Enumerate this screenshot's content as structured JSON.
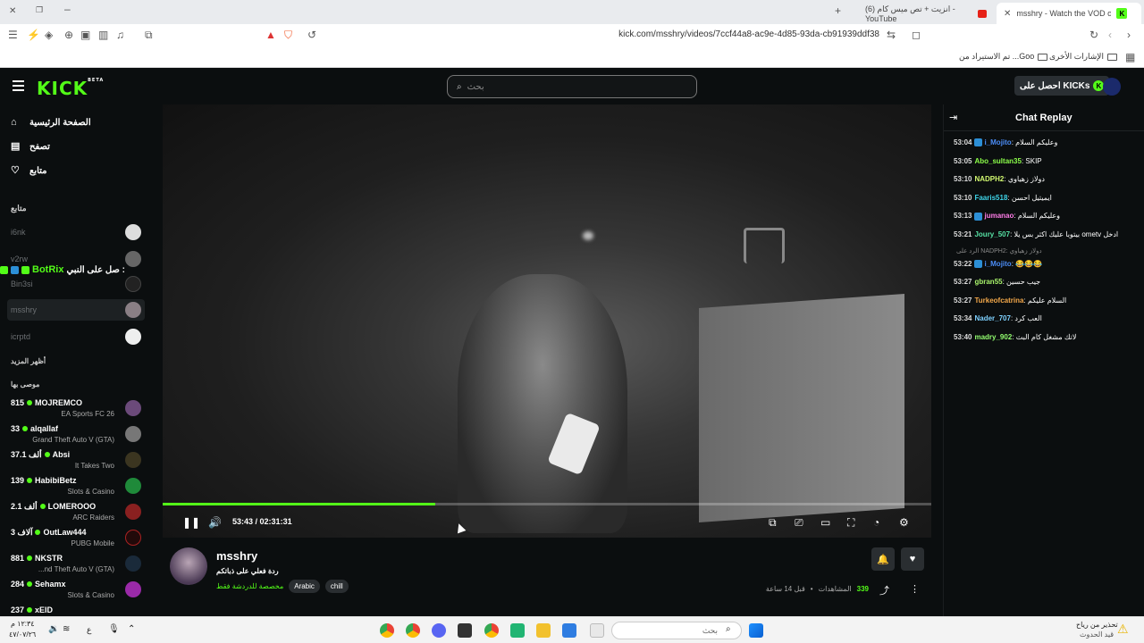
{
  "browser": {
    "tabs": [
      {
        "title": "(6) انزيت + تص ميس كام - YouTube"
      },
      {
        "title": "msshry - Watch the VOD on Kick",
        "active": true
      }
    ],
    "url": "kick.com/msshry/videos/7ccf44a8-ac9e-4d85-93da-cb91939ddf38",
    "bookmarks": [
      "الإشارات الأخرى",
      "تم الاستيراد من ...Goo"
    ]
  },
  "header": {
    "logo": "KICK",
    "logo_badge": "BETA",
    "search_placeholder": "بحث",
    "get_kicks": "احصل على KICKs"
  },
  "sidebar": {
    "nav": [
      {
        "label": "الصفحة الرئيسية",
        "icon": "home-icon"
      },
      {
        "label": "تصفح",
        "icon": "browse-icon"
      },
      {
        "label": "متابع",
        "icon": "heart-icon"
      }
    ],
    "following_title": "متابع",
    "following": [
      {
        "name": "i6nk"
      },
      {
        "name": "v2rw"
      },
      {
        "name": "Bin3si"
      },
      {
        "name": "msshry"
      },
      {
        "name": "icrptd"
      }
    ],
    "show_more": "أظهر المزيد",
    "recommended_title": "موصى بها",
    "recommended": [
      {
        "count": "815",
        "name": "MOJREMCO",
        "category": "EA Sports FC 26"
      },
      {
        "count": "33",
        "name": "alqallaf",
        "category": "Grand Theft Auto V (GTA)"
      },
      {
        "count": "37.1 ألف",
        "name": "Absi",
        "category": "It Takes Two"
      },
      {
        "count": "139",
        "name": "HabibiBetz",
        "category": "Slots & Casino"
      },
      {
        "count": "2.1 ألف",
        "name": "LOMEROOO",
        "category": "ARC Raiders"
      },
      {
        "count": "3 آلاف",
        "name": "OutLaw444",
        "category": "PUBG Mobile"
      },
      {
        "count": "881",
        "name": "NKSTR",
        "category": "...nd Theft Auto V (GTA)"
      },
      {
        "count": "284",
        "name": "Sehamx",
        "category": "Slots & Casino"
      },
      {
        "count": "237",
        "name": "xEID",
        "category": ""
      }
    ],
    "botrix_msg": "صل على النبي :",
    "botrix_name": "BotRix"
  },
  "player": {
    "time_current": "53:43",
    "time_total": "02:31:31",
    "progress": 0.355
  },
  "stream": {
    "name": "msshry",
    "title": "ردة فعلي على ذباتكم",
    "chat_note": "مخصصة للدردشة فقط",
    "tags": [
      "Arabic",
      "chill"
    ],
    "ago": "قبل 14 ساعة",
    "views_label": "المشاهدات",
    "views": "339"
  },
  "chat": {
    "title": "Chat Replay",
    "messages": [
      {
        "time": "53:04",
        "user": "i_Mojito",
        "color": "#4b8df7",
        "badge": true,
        "text": "وعليكم السلام"
      },
      {
        "time": "53:05",
        "user": "Abo_sultan35",
        "color": "#8cff4a",
        "badge": false,
        "text": "SKIP"
      },
      {
        "time": "53:10",
        "user": "NADPH2",
        "color": "#d3fa71",
        "badge": false,
        "text": "دولاز زهياوي"
      },
      {
        "time": "53:10",
        "user": "Faaris518",
        "color": "#3fd4e8",
        "badge": false,
        "text": "ايميتيل احسن"
      },
      {
        "time": "53:13",
        "user": "jumanao",
        "color": "#ff7de8",
        "badge": true,
        "text": "وعليكم السلام"
      },
      {
        "time": "53:21",
        "user": "Joury_507",
        "color": "#56e1a4",
        "badge": false,
        "text": "بيتوبا عليك اكثر بس يلا ometv ادخل"
      },
      {
        "time": "53:22",
        "user": "i_Mojito",
        "color": "#4b8df7",
        "badge": true,
        "text": "😂😂😂",
        "reply": "الرد على NADPH2: دولاز زهياوي"
      },
      {
        "time": "53:27",
        "user": "gbran55",
        "color": "#a8f36b",
        "badge": false,
        "text": "جيب حسين"
      },
      {
        "time": "53:27",
        "user": "Turkeofcatrina",
        "color": "#f3a84a",
        "badge": false,
        "text": "السلام عليكم"
      },
      {
        "time": "53:34",
        "user": "Nader_707",
        "color": "#7ed1ff",
        "badge": false,
        "text": "العب كرد"
      },
      {
        "time": "53:40",
        "user": "madry_902",
        "color": "#93ff70",
        "badge": false,
        "text": "لاتك مشغل كام البث"
      }
    ]
  },
  "taskbar": {
    "search": "بحث",
    "weather_title": "تحذير من رياح",
    "weather_sub": "قيد الحدوث",
    "time": "١٢:٣٤ م",
    "date": "٤٧/٠٧/٢٦",
    "lang": "ع"
  },
  "colors": {
    "accent": "#53fc18",
    "background": "#0b0e0f"
  }
}
